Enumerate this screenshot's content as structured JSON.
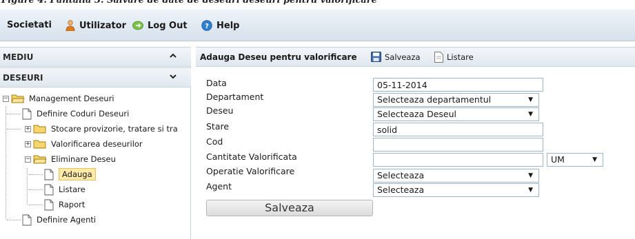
{
  "caption": "Figure 4. Pantalla 3. Salvare de date de deseuri deseuri pentru valorificare",
  "topbar": {
    "items": [
      {
        "label": "Societati",
        "icon": null
      },
      {
        "label": "Utilizator",
        "icon": "user-icon"
      },
      {
        "label": "Log Out",
        "icon": "logout-icon"
      },
      {
        "label": "Help",
        "icon": "help-icon"
      }
    ]
  },
  "sidebar": {
    "sections": [
      {
        "label": "MEDIU",
        "chevron": "chevron-up-icon"
      },
      {
        "label": "DESEURI",
        "chevron": "chevron-down-icon"
      }
    ],
    "tree": [
      {
        "label": "Management Deseuri",
        "type": "folder-open",
        "expander": "minus"
      },
      {
        "label": "Definire Coduri Deseuri",
        "type": "document"
      },
      {
        "label": "Stocare provizorie, tratare si tra",
        "type": "folder",
        "expander": "plus"
      },
      {
        "label": "Valorificarea deseurilor",
        "type": "folder",
        "expander": "plus"
      },
      {
        "label": "Eliminare Deseu",
        "type": "folder-open",
        "expander": "minus"
      },
      {
        "label": "Adauga",
        "type": "document",
        "selected": true
      },
      {
        "label": "Listare",
        "type": "document"
      },
      {
        "label": "Raport",
        "type": "document"
      },
      {
        "label": "Definire Agenti",
        "type": "document"
      }
    ]
  },
  "panel": {
    "title": "Adauga Deseu pentru valorificare",
    "tools": [
      {
        "label": "Salveaza",
        "icon": "save-icon"
      },
      {
        "label": "Listare",
        "icon": "document-icon"
      }
    ]
  },
  "form": {
    "fields": [
      {
        "label": "Data",
        "kind": "input",
        "value": "05-11-2014"
      },
      {
        "label": "Departament",
        "kind": "select",
        "value": "Selecteaza departamentul"
      },
      {
        "label": "Deseu",
        "kind": "select",
        "value": "Selecteaza Deseul"
      },
      {
        "label": "Stare",
        "kind": "input",
        "value": "solid"
      },
      {
        "label": "Cod",
        "kind": "input",
        "value": ""
      },
      {
        "label": "Cantitate Valorificata",
        "kind": "input",
        "value": ""
      },
      {
        "label": "Operatie Valorificare",
        "kind": "select",
        "value": "Selecteaza"
      },
      {
        "label": "Agent",
        "kind": "select",
        "value": "Selecteaza"
      }
    ],
    "unit_select": "UM",
    "submit_label": "Salveaza"
  }
}
